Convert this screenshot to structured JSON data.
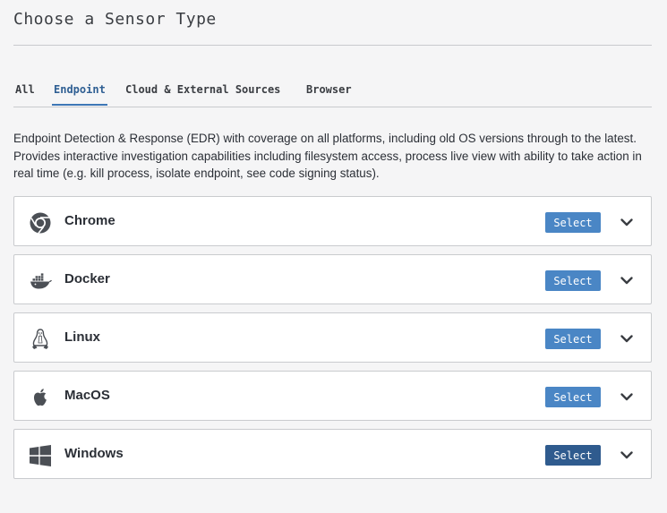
{
  "page": {
    "title": "Choose a Sensor Type"
  },
  "tabs": [
    {
      "label": "All",
      "active": false
    },
    {
      "label": "Endpoint",
      "active": true
    },
    {
      "label": "Cloud & External Sources",
      "active": false
    },
    {
      "label": "Browser",
      "active": false
    }
  ],
  "description": "Endpoint Detection & Response (EDR) with coverage on all platforms, including old OS versions through to the latest. Provides interactive investigation capabilities including filesystem access, process live view with ability to take action in real time (e.g. kill process, isolate endpoint, see code signing status).",
  "sensors": [
    {
      "name": "Chrome",
      "icon": "chrome-icon",
      "select_label": "Select"
    },
    {
      "name": "Docker",
      "icon": "docker-icon",
      "select_label": "Select"
    },
    {
      "name": "Linux",
      "icon": "linux-icon",
      "select_label": "Select"
    },
    {
      "name": "MacOS",
      "icon": "apple-icon",
      "select_label": "Select"
    },
    {
      "name": "Windows",
      "icon": "windows-icon",
      "select_label": "Select"
    }
  ],
  "colors": {
    "accent": "#4a86c5",
    "accent_hover": "#2f5b8e",
    "active_tab": "#2f5f93",
    "background": "#f5f5f6",
    "icon": "#4b4f55"
  }
}
